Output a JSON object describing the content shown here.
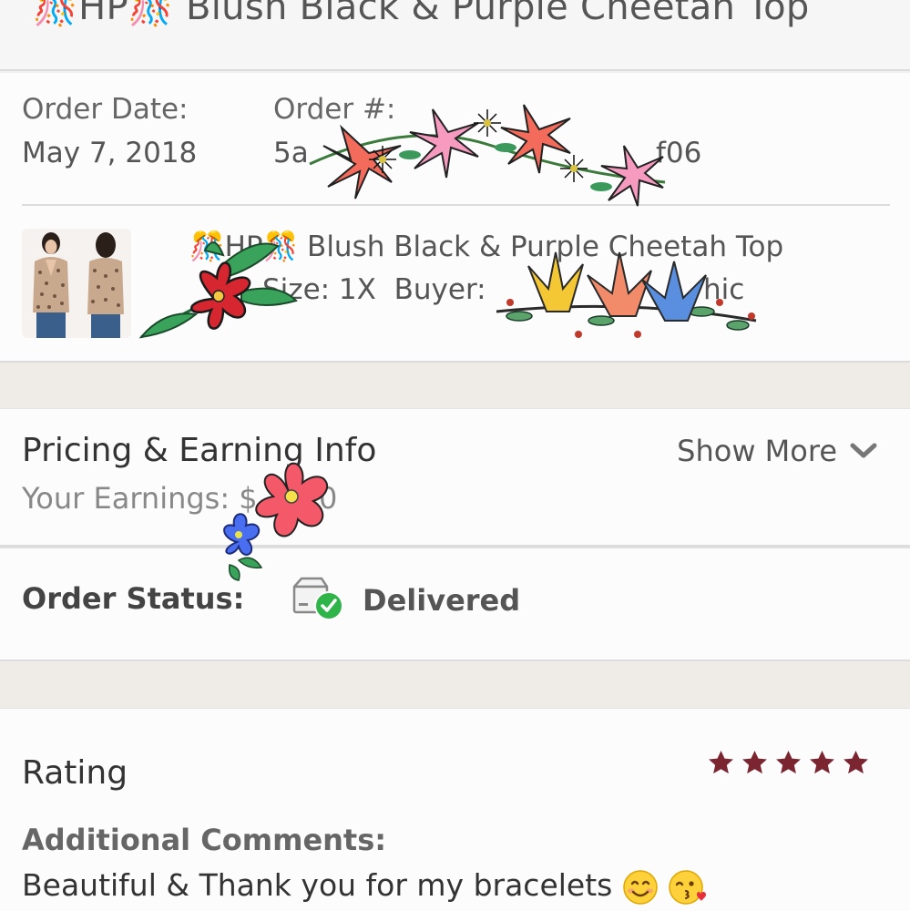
{
  "header": {
    "title": "🎊HP🎊 Blush Black & Purple Cheetah Top",
    "title_icons": [
      "confetti-icon",
      "confetti-icon"
    ]
  },
  "order": {
    "date_label": "Order Date:",
    "date_value": "May 7, 2018",
    "number_label": "Order #:",
    "number_value_start": "5a",
    "number_value_end": "f06"
  },
  "item": {
    "title": "🎊HP🎊 Blush Black & Purple Cheetah Top",
    "size_label": "Size: 1X",
    "buyer_label": "Buyer:",
    "buyer_value_end": "hic"
  },
  "pricing": {
    "heading": "Pricing & Earning Info",
    "earnings_label": "Your Earnings: $",
    "earnings_value_end": "0",
    "show_more": "Show More"
  },
  "status": {
    "label": "Order Status:",
    "value": "Delivered",
    "icon": "delivered-box-check-icon"
  },
  "rating": {
    "heading": "Rating",
    "stars": 5,
    "star_color": "#7b2530",
    "comments_label": "Additional Comments:",
    "comments_text": "Beautiful & Thank you for my bracelets",
    "comment_emojis": [
      "smiling-face-emoji",
      "kissing-face-emoji"
    ]
  },
  "colors": {
    "divider": "#dcdcdc",
    "section_gap": "#efece8",
    "text_primary": "#333333",
    "text_secondary": "#666666",
    "delivered_green": "#2fb44a"
  }
}
